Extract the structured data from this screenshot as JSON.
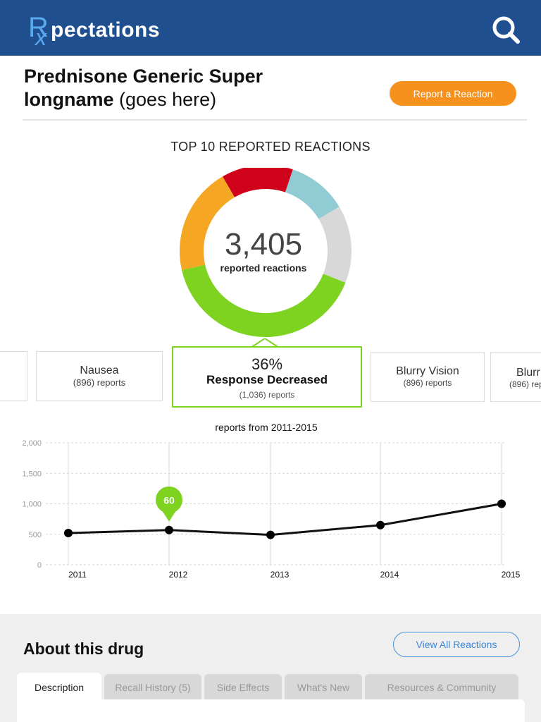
{
  "header": {
    "logo_r": "R",
    "logo_x": "x",
    "logo_text": "pectations",
    "search_icon": "search-icon"
  },
  "drug": {
    "name_bold_line1": "Prednisone Generic Super",
    "name_bold_line2": "longname",
    "name_suffix": "(goes here)",
    "report_button": "Report a Reaction"
  },
  "reactions": {
    "title": "TOP 10 REPORTED REACTIONS",
    "total": "3,405",
    "total_caption": "reported reactions",
    "segments": [
      {
        "color": "#d0021b",
        "value": 12
      },
      {
        "color": "#91ccd4",
        "value": 10
      },
      {
        "color": "#d8d8d8",
        "value": 13
      },
      {
        "color": "#7ed321",
        "value": 36
      },
      {
        "color": "#f5a623",
        "value": 18
      }
    ],
    "cards": {
      "nausea": {
        "name": "Nausea",
        "count": "(896) reports"
      },
      "selected": {
        "pct": "36%",
        "name": "Response Decreased",
        "count": "(1,036) reports"
      },
      "blurry": {
        "name": "Blurry Vision",
        "count": "(896) reports"
      },
      "partial": {
        "name": "Blurr",
        "count": "(896) rep"
      }
    }
  },
  "chart_data": {
    "type": "line",
    "title": "reports from 2011-2015",
    "x": [
      "2011",
      "2012",
      "2013",
      "2014",
      "2015"
    ],
    "y_ticks": [
      "2,000",
      "1,500",
      "1,000",
      "500",
      "0"
    ],
    "ylim": [
      0,
      2000
    ],
    "series": [
      {
        "values": [
          520,
          570,
          490,
          650,
          1000
        ]
      }
    ],
    "highlight": {
      "index": 1,
      "label": "60",
      "color": "#7ed321"
    },
    "grid": true
  },
  "about": {
    "title": "About this drug",
    "view_all": "View All Reactions",
    "tabs": [
      "Description",
      "Recall History (5)",
      "Side Effects",
      "What's New",
      "Resources & Community"
    ]
  },
  "colors": {
    "brand": "#1f4f8f",
    "accent": "#f6911e",
    "selected": "#7ed321",
    "link": "#3b86d6"
  }
}
